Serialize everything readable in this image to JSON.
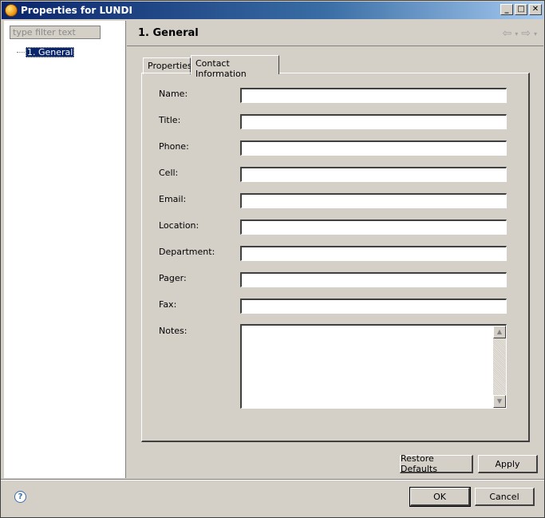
{
  "window": {
    "title": "Properties for LUNDI",
    "controls": {
      "minimize": "_",
      "maximize": "□",
      "close": "✕"
    }
  },
  "sidebar": {
    "filter": {
      "placeholder": "type filter text",
      "value": ""
    },
    "items": [
      {
        "label": "1. General",
        "selected": true
      }
    ]
  },
  "header": {
    "title": "1. General",
    "nav": {
      "back": "⇦",
      "forward": "⇨",
      "dropdown": "▾"
    }
  },
  "tabs": [
    {
      "label": "Properties",
      "active": false
    },
    {
      "label": "Contact Information",
      "active": true
    }
  ],
  "form": {
    "fields": [
      {
        "label": "Name:",
        "value": ""
      },
      {
        "label": "Title:",
        "value": ""
      },
      {
        "label": "Phone:",
        "value": ""
      },
      {
        "label": "Cell:",
        "value": ""
      },
      {
        "label": "Email:",
        "value": ""
      },
      {
        "label": "Location:",
        "value": ""
      },
      {
        "label": "Department:",
        "value": ""
      },
      {
        "label": "Pager:",
        "value": ""
      },
      {
        "label": "Fax:",
        "value": ""
      }
    ],
    "notes": {
      "label": "Notes:",
      "value": ""
    }
  },
  "buttons": {
    "restore_defaults": "Restore Defaults",
    "apply": "Apply",
    "ok": "OK",
    "cancel": "Cancel"
  },
  "help": {
    "icon": "?"
  },
  "colors": {
    "title_bar": "#0a246a",
    "face": "#d4d0c8",
    "selection": "#0a246a"
  }
}
